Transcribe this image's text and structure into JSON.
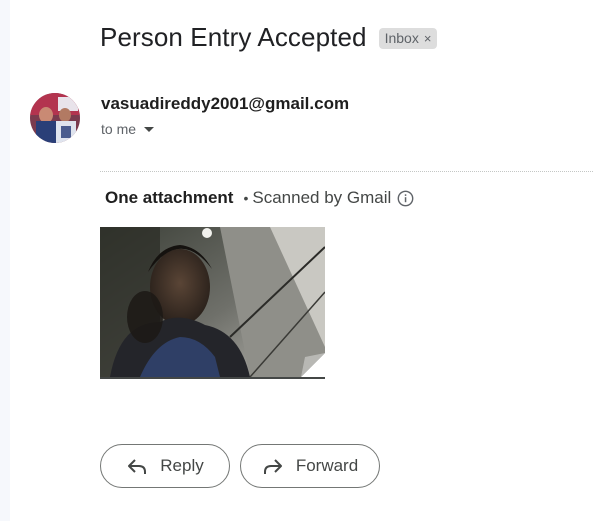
{
  "email": {
    "subject": "Person Entry Accepted",
    "label": "Inbox",
    "label_remove_icon": "close-icon",
    "sender": "vasuadireddy2001@gmail.com",
    "recipient": "to me"
  },
  "attachments": {
    "title": "One attachment",
    "separator": "•",
    "scan_status": "Scanned by Gmail",
    "info_icon": "info-icon"
  },
  "actions": {
    "reply_label": "Reply",
    "forward_label": "Forward",
    "reply_icon": "reply-arrow-icon",
    "forward_icon": "forward-arrow-icon"
  },
  "colors": {
    "chip_bg": "#dddddd",
    "text_primary": "#202124",
    "text_secondary": "#5f6368",
    "button_border": "#747775"
  }
}
